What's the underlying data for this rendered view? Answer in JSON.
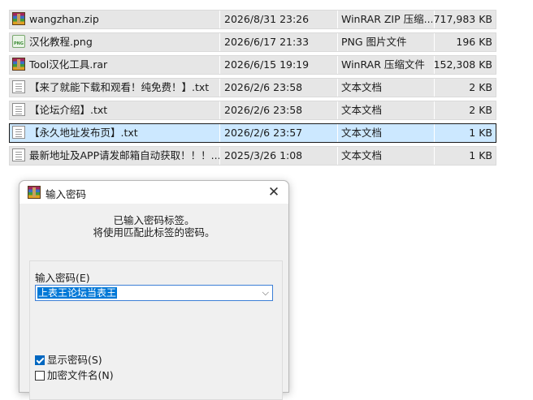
{
  "files": [
    {
      "name": "wangzhan.zip",
      "date": "2026/8/31 23:26",
      "type": "WinRAR ZIP 压缩...",
      "size": "717,983 KB",
      "icon": "rar-archive-icon",
      "selected": false
    },
    {
      "name": "汉化教程.png",
      "date": "2026/6/17 21:33",
      "type": "PNG 图片文件",
      "size": "196 KB",
      "icon": "png-file-icon",
      "selected": false
    },
    {
      "name": "Tool汉化工具.rar",
      "date": "2026/6/15 19:19",
      "type": "WinRAR 压缩文件",
      "size": "152,308 KB",
      "icon": "rar-archive-icon",
      "selected": false
    },
    {
      "name": "【来了就能下载和观看！纯免费！】.txt",
      "date": "2026/2/6 23:58",
      "type": "文本文档",
      "size": "2 KB",
      "icon": "text-file-icon",
      "selected": false
    },
    {
      "name": "【论坛介绍】.txt",
      "date": "2026/2/6 23:58",
      "type": "文本文档",
      "size": "2 KB",
      "icon": "text-file-icon",
      "selected": false
    },
    {
      "name": "【永久地址发布页】.txt",
      "date": "2026/2/6 23:57",
      "type": "文本文档",
      "size": "1 KB",
      "icon": "text-file-icon",
      "selected": true
    },
    {
      "name": "最新地址及APP请发邮箱自动获取！！！....",
      "date": "2025/3/26 1:08",
      "type": "文本文档",
      "size": "1 KB",
      "icon": "text-file-icon",
      "selected": false
    }
  ],
  "dialog": {
    "title": "输入密码",
    "message_line1": "已输入密码标签。",
    "message_line2": "将使用匹配此标签的密码。",
    "password_label": "输入密码(E)",
    "password_value": "上表王论坛当表王",
    "show_password_label": "显示密码(S)",
    "show_password_checked": true,
    "encrypt_filenames_label": "加密文件名(N)",
    "encrypt_filenames_checked": false,
    "close_glyph": "✕",
    "dropdown_glyph": "⌵"
  },
  "colors": {
    "row_background": "#e6e6e6",
    "selected_row_background": "#cce8ff",
    "selection_highlight": "#0078d7",
    "checkbox_checked": "#0067c0"
  }
}
